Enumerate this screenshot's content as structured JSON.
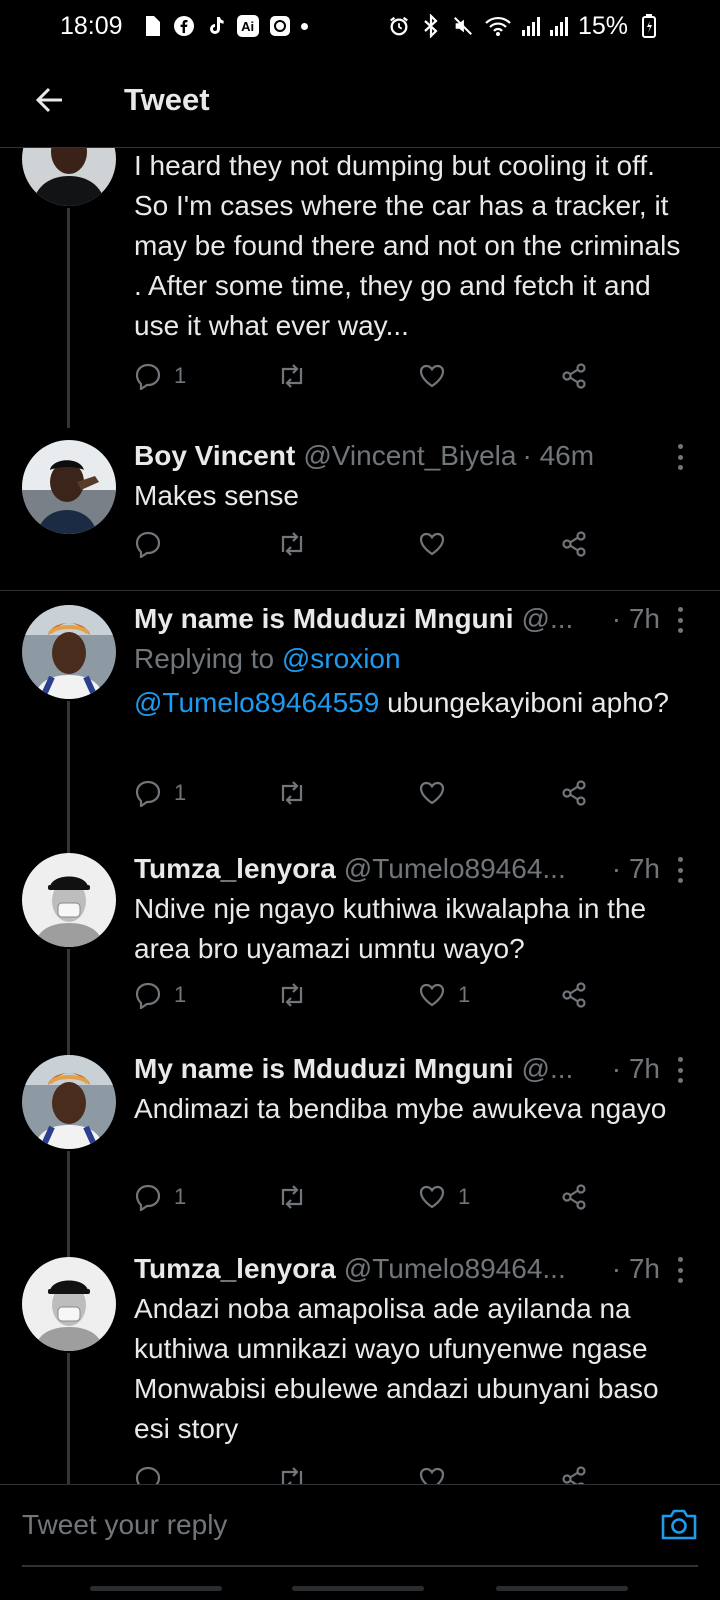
{
  "status_bar": {
    "time": "18:09",
    "battery": "15%",
    "icons": [
      "sim-icon",
      "facebook-icon",
      "tiktok-icon",
      "ai-icon",
      "messenger-icon",
      "alarm-icon",
      "bluetooth-icon",
      "mute-icon",
      "wifi-icon",
      "signal-icon",
      "battery-icon"
    ]
  },
  "header": {
    "title": "Tweet"
  },
  "tweets": [
    {
      "body": "I heard they not dumping but cooling it off. So I'm cases where the car has a tracker, it may be found there and not on the criminals . After some time, they go and fetch it and use it what ever way...",
      "reply_count": "1",
      "like_count": ""
    },
    {
      "name": "Boy Vincent",
      "handle": "@Vincent_Biyela",
      "time": "· 46m",
      "body": "Makes sense",
      "reply_count": "",
      "like_count": ""
    },
    {
      "name": "My name is Mduduzi Mnguni",
      "handle": "@...",
      "time": "· 7h",
      "replying_prefix": "Replying to",
      "replying_to": "@sroxion",
      "body_mention": "@Tumelo89464559",
      "body": "ubungekayiboni apho?",
      "reply_count": "1",
      "like_count": ""
    },
    {
      "name": "Tumza_lenyora",
      "handle": "@Tumelo89464...",
      "time": "· 7h",
      "body": "Ndive nje ngayo kuthiwa ikwalapha in the area bro uyamazi umntu wayo?",
      "reply_count": "1",
      "like_count": "1"
    },
    {
      "name": "My name is Mduduzi Mnguni",
      "handle": "@...",
      "time": "· 7h",
      "body": "Andimazi ta bendiba mybe awukeva ngayo",
      "reply_count": "1",
      "like_count": "1"
    },
    {
      "name": "Tumza_lenyora",
      "handle": "@Tumelo89464...",
      "time": "· 7h",
      "body": "Andazi noba amapolisa ade ayilanda na kuthiwa umnikazi wayo ufunyenwe ngase Monwabisi ebulewe andazi ubunyani baso esi story",
      "reply_count": "",
      "like_count": ""
    }
  ],
  "reply_box": {
    "placeholder": "Tweet your reply"
  },
  "colors": {
    "background": "#000000",
    "text": "#e7e9ea",
    "secondary": "#71767b",
    "accent": "#1d9bf0",
    "divider": "#2f3336"
  }
}
